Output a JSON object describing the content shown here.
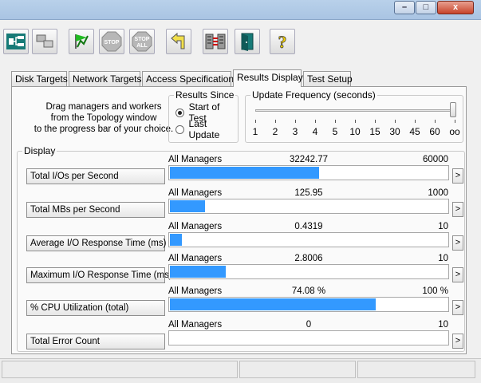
{
  "window": {
    "controls": {
      "minimize": "–",
      "maximize": "□",
      "close": "x"
    }
  },
  "toolbar": {
    "buttons": [
      {
        "name": "show-topology-icon",
        "label": ""
      },
      {
        "name": "new-manager-icon",
        "label": ""
      },
      {
        "name": "start-tests-icon",
        "label": ""
      },
      {
        "name": "stop-icon",
        "label": "STOP"
      },
      {
        "name": "stop-all-icon",
        "label": "STOP ALL"
      },
      {
        "name": "reset-workers-icon",
        "label": ""
      },
      {
        "name": "disconnect-icon",
        "label": ""
      },
      {
        "name": "exit-icon",
        "label": ""
      },
      {
        "name": "help-icon",
        "label": "?"
      }
    ]
  },
  "tabs": [
    {
      "label": "Disk Targets",
      "active": false
    },
    {
      "label": "Network Targets",
      "active": false
    },
    {
      "label": "Access Specifications",
      "active": false
    },
    {
      "label": "Results Display",
      "active": true
    },
    {
      "label": "Test Setup",
      "active": false
    }
  ],
  "help_text": {
    "line1": "Drag managers and workers",
    "line2": "from the Topology window",
    "line3": "to the progress bar of your choice."
  },
  "results_since": {
    "title": "Results Since",
    "options": [
      {
        "label": "Start of Test",
        "selected": true
      },
      {
        "label": "Last Update",
        "selected": false
      }
    ]
  },
  "update_frequency": {
    "title": "Update Frequency (seconds)",
    "ticks": [
      "1",
      "2",
      "3",
      "4",
      "5",
      "10",
      "15",
      "30",
      "45",
      "60",
      "oo"
    ],
    "selected": "oo"
  },
  "display": {
    "title": "Display",
    "rows": [
      {
        "metric": "Total I/Os per Second",
        "target": "All Managers",
        "value": "32242.77",
        "max": "60000",
        "fraction": 0.537
      },
      {
        "metric": "Total MBs per Second",
        "target": "All Managers",
        "value": "125.95",
        "max": "1000",
        "fraction": 0.126
      },
      {
        "metric": "Average I/O Response Time (ms)",
        "target": "All Managers",
        "value": "0.4319",
        "max": "10",
        "fraction": 0.043
      },
      {
        "metric": "Maximum I/O Response Time (ms)",
        "target": "All Managers",
        "value": "2.8006",
        "max": "10",
        "fraction": 0.2
      },
      {
        "metric": "% CPU Utilization (total)",
        "target": "All Managers",
        "value": "74.08 %",
        "max": "100 %",
        "fraction": 0.74
      },
      {
        "metric": "Total Error Count",
        "target": "All Managers",
        "value": "0",
        "max": "10",
        "fraction": 0.0
      }
    ],
    "expand_label": ">"
  },
  "colors": {
    "bar": "#3399ff",
    "tab_border": "#9a9a9a"
  }
}
